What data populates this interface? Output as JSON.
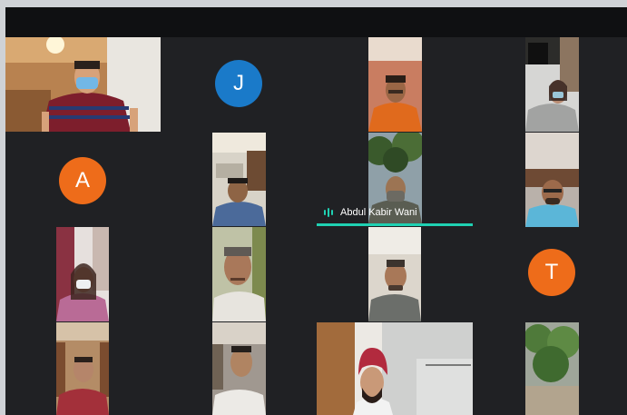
{
  "meeting": {
    "active_speaker": "Abdul Kabir Wani",
    "accent_color": "#1fd0b2",
    "participants": [
      {
        "id": "p1",
        "kind": "video"
      },
      {
        "id": "p2",
        "kind": "avatar",
        "initial": "J",
        "color": "#1a7ac9"
      },
      {
        "id": "p3",
        "kind": "video"
      },
      {
        "id": "p4",
        "kind": "video"
      },
      {
        "id": "p5",
        "kind": "avatar",
        "initial": "A",
        "color": "#ee6c1a"
      },
      {
        "id": "p6",
        "kind": "video"
      },
      {
        "id": "p7",
        "kind": "video",
        "name": "Abdul Kabir Wani"
      },
      {
        "id": "p8",
        "kind": "video"
      },
      {
        "id": "p9",
        "kind": "video"
      },
      {
        "id": "p10",
        "kind": "video"
      },
      {
        "id": "p11",
        "kind": "video"
      },
      {
        "id": "p12",
        "kind": "avatar",
        "initial": "T",
        "color": "#ee6c1a"
      },
      {
        "id": "p13",
        "kind": "video"
      },
      {
        "id": "p14",
        "kind": "video"
      },
      {
        "id": "p15",
        "kind": "video"
      },
      {
        "id": "p16",
        "kind": "video"
      }
    ]
  }
}
